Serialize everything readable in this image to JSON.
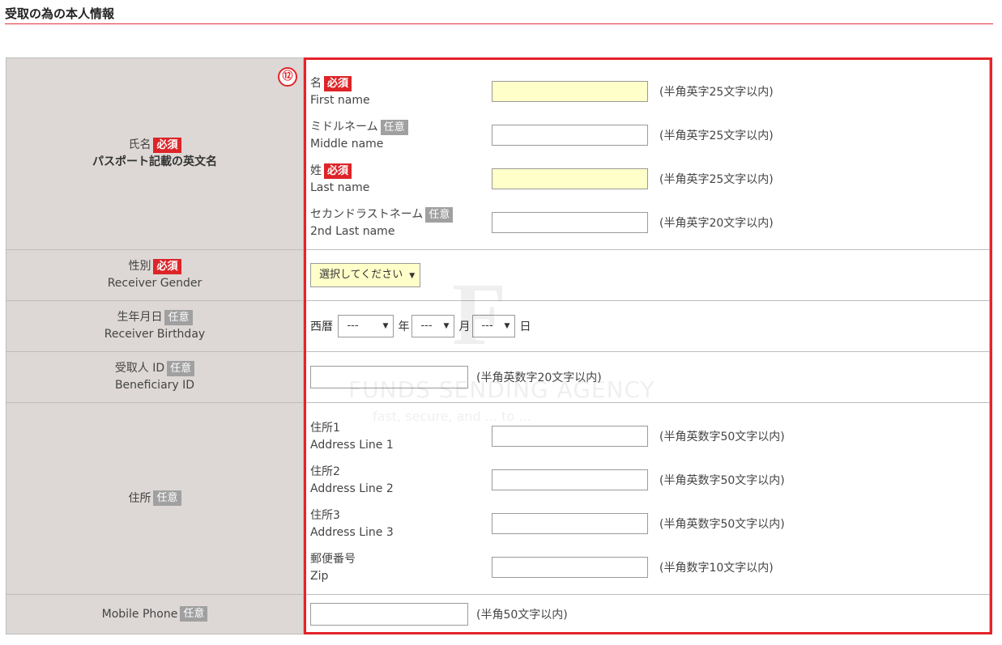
{
  "section_title": "受取の為の本人情報",
  "marker_number": "⑫",
  "badges": {
    "required": "必須",
    "optional": "任意"
  },
  "name_row": {
    "label_jp": "氏名",
    "label_sub": "パスポート記載の英文名",
    "fields": [
      {
        "jp": "名",
        "en": "First name",
        "badge": "必須",
        "hint": "(半角英字25文字以内)",
        "value": ""
      },
      {
        "jp": "ミドルネーム",
        "en": "Middle name",
        "badge": "任意",
        "hint": "(半角英字25文字以内)",
        "value": ""
      },
      {
        "jp": "姓",
        "en": "Last name",
        "badge": "必須",
        "hint": "(半角英字25文字以内)",
        "value": ""
      },
      {
        "jp": "セカンドラストネーム",
        "en": "2nd Last name",
        "badge": "任意",
        "hint": "(半角英字20文字以内)",
        "value": ""
      }
    ]
  },
  "gender_row": {
    "label_jp": "性別",
    "label_en": "Receiver Gender",
    "badge": "必須",
    "selected": "選択してください"
  },
  "birthday_row": {
    "label_jp": "生年月日",
    "label_en": "Receiver Birthday",
    "badge": "任意",
    "era": "西暦",
    "year_value": "---",
    "year_unit": "年",
    "month_value": "---",
    "month_unit": "月",
    "day_value": "---",
    "day_unit": "日"
  },
  "beneficiary_row": {
    "label_jp": "受取人 ID",
    "label_en": "Beneficiary ID",
    "badge": "任意",
    "hint": "(半角英数字20文字以内)",
    "value": ""
  },
  "address_row": {
    "label_jp": "住所",
    "badge": "任意",
    "fields": [
      {
        "jp": "住所1",
        "en": "Address Line 1",
        "hint": "(半角英数字50文字以内)",
        "value": ""
      },
      {
        "jp": "住所2",
        "en": "Address Line 2",
        "hint": "(半角英数字50文字以内)",
        "value": ""
      },
      {
        "jp": "住所3",
        "en": "Address Line 3",
        "hint": "(半角英数字50文字以内)",
        "value": ""
      },
      {
        "jp": "郵便番号",
        "en": "Zip",
        "hint": "(半角数字10文字以内)",
        "value": ""
      }
    ]
  },
  "mobile_row": {
    "label_en": "Mobile Phone",
    "badge": "任意",
    "hint": "(半角50文字以内)",
    "value": ""
  },
  "watermark": {
    "letter": "F",
    "name": "FUNDS SENDING AGENCY",
    "tagline": "fast, secure, and ... to ..."
  },
  "colors": {
    "accent_red": "#e4232a",
    "required_yellow": "#ffffc9",
    "label_bg": "#ddd8d6",
    "optional_gray": "#a0a0a0"
  }
}
